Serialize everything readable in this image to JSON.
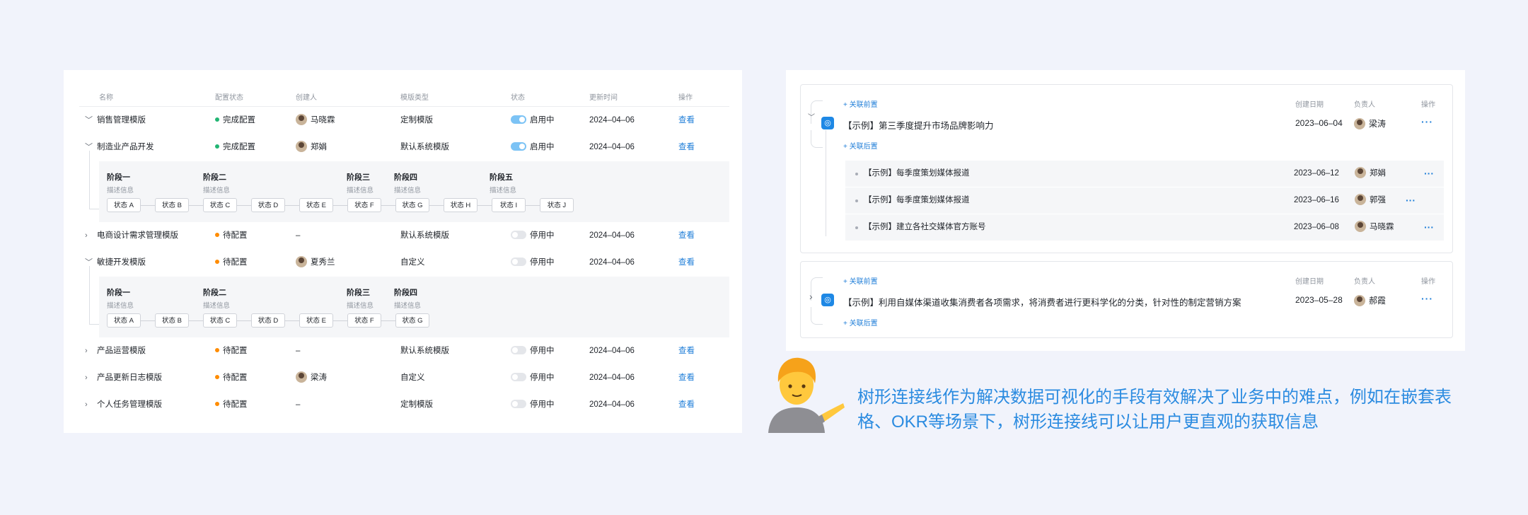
{
  "table": {
    "headers": [
      "名称",
      "配置状态",
      "创建人",
      "模版类型",
      "状态",
      "更新时间",
      "操作"
    ],
    "rows": [
      {
        "name": "销售管理模版",
        "expand": "﹀",
        "config": "完成配置",
        "config_color": "#22b573",
        "creator": "马晓霖",
        "type": "定制模版",
        "status": "启用中",
        "status_on": true,
        "time": "2024–04–06",
        "action": "查看"
      },
      {
        "name": "制造业产品开发",
        "expand": "﹀",
        "config": "完成配置",
        "config_color": "#22b573",
        "creator": "郑娟",
        "type": "默认系统模版",
        "status": "启用中",
        "status_on": true,
        "time": "2024–04–06",
        "action": "查看"
      },
      {
        "name": "电商设计需求管理模版",
        "expand": "›",
        "config": "待配置",
        "config_color": "#ff8c00",
        "creator": "–",
        "type": "默认系统模版",
        "status": "停用中",
        "status_on": false,
        "time": "2024–04–06",
        "action": "查看"
      },
      {
        "name": "敏捷开发模版",
        "expand": "﹀",
        "config": "待配置",
        "config_color": "#ff8c00",
        "creator": "夏秀兰",
        "type": "自定义",
        "status": "停用中",
        "status_on": false,
        "time": "2024–04–06",
        "action": "查看"
      },
      {
        "name": "产品运营模版",
        "expand": "›",
        "config": "待配置",
        "config_color": "#ff8c00",
        "creator": "–",
        "type": "默认系统模版",
        "status": "停用中",
        "status_on": false,
        "time": "2024–04–06",
        "action": "查看"
      },
      {
        "name": "产品更新日志模版",
        "expand": "›",
        "config": "待配置",
        "config_color": "#ff8c00",
        "creator": "梁涛",
        "type": "自定义",
        "status": "停用中",
        "status_on": false,
        "time": "2024–04–06",
        "action": "查看"
      },
      {
        "name": "个人任务管理模版",
        "expand": "›",
        "config": "待配置",
        "config_color": "#ff8c00",
        "creator": "–",
        "type": "定制模版",
        "status": "停用中",
        "status_on": false,
        "time": "2024–04–06",
        "action": "查看"
      }
    ],
    "stages_a": {
      "stages": [
        {
          "title": "阶段一",
          "desc": "描述信息"
        },
        {
          "title": "阶段二",
          "desc": "描述信息"
        },
        {
          "title": "阶段三",
          "desc": "描述信息"
        },
        {
          "title": "阶段四",
          "desc": "描述信息"
        },
        {
          "title": "阶段五",
          "desc": "描述信息"
        }
      ],
      "chips": [
        "状态 A",
        "状态 B",
        "状态 C",
        "状态 D",
        "状态 E",
        "状态 F",
        "状态 G",
        "状态 H",
        "状态 I",
        "状态 J"
      ]
    },
    "stages_b": {
      "stages": [
        {
          "title": "阶段一",
          "desc": "描述信息"
        },
        {
          "title": "阶段二",
          "desc": "描述信息"
        },
        {
          "title": "阶段三",
          "desc": "描述信息"
        },
        {
          "title": "阶段四",
          "desc": "描述信息"
        }
      ],
      "chips": [
        "状态 A",
        "状态 B",
        "状态 C",
        "状态 D",
        "状态 E",
        "状态 F",
        "状态 G"
      ]
    }
  },
  "okr": {
    "headers": {
      "date": "创建日期",
      "owner": "负责人",
      "action": "操作"
    },
    "add_prev": "+ 关联前置",
    "add_next": "+ 关联后置",
    "card1": {
      "icon": "target-icon",
      "title": "【示例】第三季度提升市场品牌影响力",
      "date": "2023–06–04",
      "owner": "梁涛",
      "more": "···",
      "subs": [
        {
          "title": "【示例】每季度策划媒体报道",
          "date": "2023–06–12",
          "owner": "郑娟"
        },
        {
          "title": "【示例】每季度策划媒体报道",
          "date": "2023–06–16",
          "owner": "郭强"
        },
        {
          "title": "【示例】建立各社交媒体官方账号",
          "date": "2023–06–08",
          "owner": "马晓霖"
        }
      ]
    },
    "card2": {
      "icon": "target-icon",
      "title": "【示例】利用自媒体渠道收集消费者各项需求，将消费者进行更科学化的分类，针对性的制定营销方案",
      "date": "2023–05–28",
      "owner": "郝霞",
      "more": "···"
    }
  },
  "caption": "树形连接线作为解决数据可视化的手段有效解决了业务中的难点，例如在嵌套表格、OKR等场景下，树形连接线可以让用户更直观的获取信息",
  "colors": {
    "accent": "#1f7ed8",
    "done": "#22b573",
    "pending": "#ff8c00",
    "caption": "#2b8be0"
  }
}
